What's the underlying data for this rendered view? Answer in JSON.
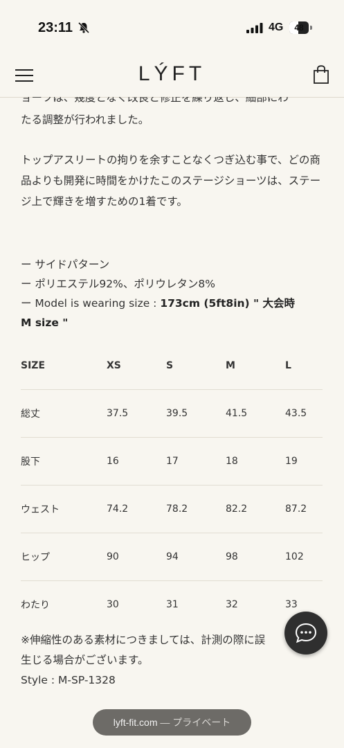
{
  "status_bar": {
    "time": "23:11",
    "network": "4G",
    "battery": "48",
    "battery_fraction": 0.48
  },
  "header": {
    "logo": "LÝFT"
  },
  "description": {
    "cut_line": "ョーツは、幾度となく改良と修正を繰り返し、細部にわ",
    "line1": "たる調整が行われました。",
    "para2": "トップアスリートの拘りを余すことなくつぎ込む事で、どの商品よりも開発に時間をかけたこのステージショーツは、ステージ上で輝きを増すための1着です。"
  },
  "specs": {
    "item1": "ー サイドパターン",
    "item2": "ー ポリエステル92%、ポリウレタン8%",
    "item3_prefix": "ー Model is wearing size : ",
    "item3_bold": "173cm (5ft8in) \" 大会時 M size \""
  },
  "size_table": {
    "headers": [
      "SIZE",
      "XS",
      "S",
      "M",
      "L"
    ],
    "rows": [
      {
        "label": "総丈",
        "values": [
          "37.5",
          "39.5",
          "41.5",
          "43.5"
        ]
      },
      {
        "label": "股下",
        "values": [
          "16",
          "17",
          "18",
          "19"
        ]
      },
      {
        "label": "ウェスト",
        "values": [
          "74.2",
          "78.2",
          "82.2",
          "87.2"
        ]
      },
      {
        "label": "ヒップ",
        "values": [
          "90",
          "94",
          "98",
          "102"
        ]
      },
      {
        "label": "わたり",
        "values": [
          "30",
          "31",
          "32",
          "33"
        ]
      }
    ]
  },
  "notes": {
    "line1": "※伸縮性のある素材につきましては、計測の際に誤",
    "line2": "生じる場合がございます。",
    "style": "Style : M-SP-1328"
  },
  "browser": {
    "domain": "lyft-fit.com",
    "mode": " — プライベート"
  },
  "icons": {
    "menu": "hamburger-icon",
    "cart": "shopping-bag-icon",
    "chat": "chat-bubble-icon",
    "bell": "bell-slash-icon",
    "signal": "signal-bars-icon"
  }
}
